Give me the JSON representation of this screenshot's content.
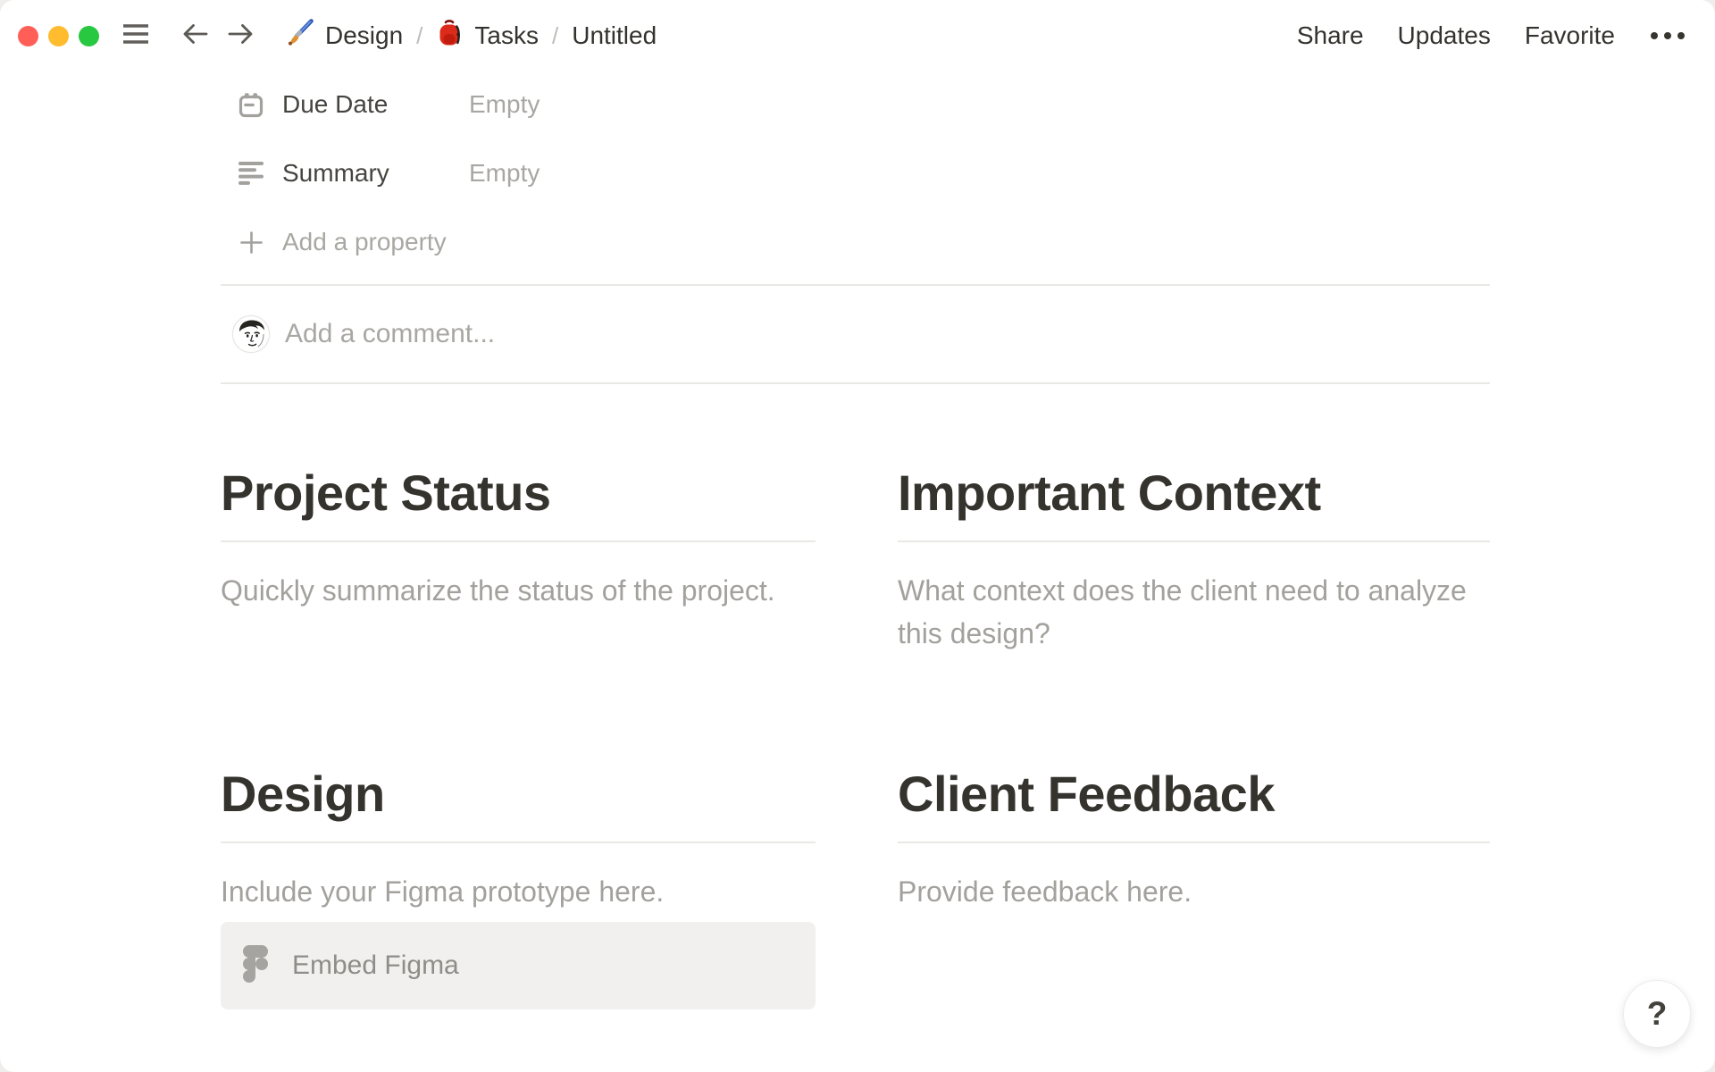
{
  "window": {
    "controls": [
      {
        "name": "close",
        "color": "#ff5f57"
      },
      {
        "name": "minimize",
        "color": "#febc2e"
      },
      {
        "name": "zoom",
        "color": "#28c840"
      }
    ]
  },
  "topbar": {
    "breadcrumb": {
      "items": [
        {
          "icon": "paintbrush-emoji",
          "label": "Design"
        },
        {
          "icon": "backpack-emoji",
          "label": "Tasks"
        },
        {
          "icon": null,
          "label": "Untitled"
        }
      ],
      "separator": "/"
    },
    "actions": {
      "share": "Share",
      "updates": "Updates",
      "favorite": "Favorite",
      "more": "more-options-icon"
    }
  },
  "properties": {
    "rows": [
      {
        "icon": "calendar-icon",
        "label": "Due Date",
        "value": "Empty"
      },
      {
        "icon": "text-lines-icon",
        "label": "Summary",
        "value": "Empty"
      }
    ],
    "add_property": "Add a property"
  },
  "comment": {
    "avatar": "user-avatar-sketch",
    "placeholder": "Add a comment..."
  },
  "sections": [
    {
      "title": "Project Status",
      "body": "Quickly summarize the status of the project."
    },
    {
      "title": "Important Context",
      "body": "What context does the client need to analyze this design?"
    },
    {
      "title": "Design",
      "body": "Include your Figma prototype here.",
      "embed_button": "Embed Figma"
    },
    {
      "title": "Client Feedback",
      "body": "Provide feedback here."
    }
  ],
  "help": {
    "label": "?"
  },
  "colors": {
    "text_dark": "#37352f",
    "text_muted": "#a3a19d",
    "divider": "#e9e8e5",
    "embed_button_bg": "#f1f0ee",
    "icon_gray": "#a2a19d"
  }
}
